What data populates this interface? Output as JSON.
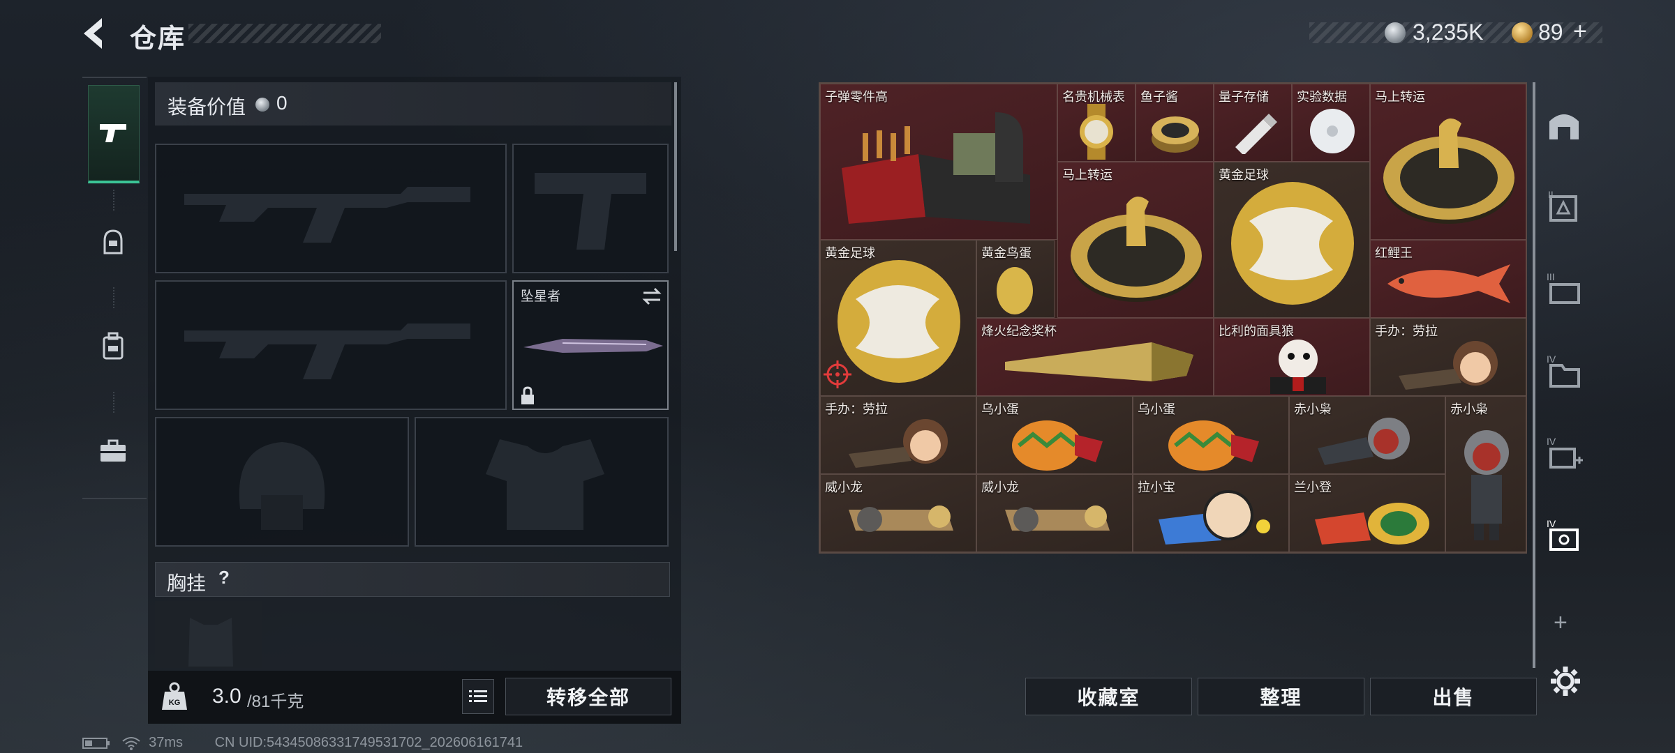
{
  "header": {
    "title": "仓库",
    "currency_silver": "3,235K",
    "currency_gold": "89",
    "gold_plus": "+"
  },
  "left_nav": {
    "items": [
      {
        "name": "weapon",
        "icon": "pistol-icon"
      },
      {
        "name": "helmet",
        "icon": "helmet-icon"
      },
      {
        "name": "backpack",
        "icon": "backpack-icon"
      },
      {
        "name": "case",
        "icon": "briefcase-icon"
      }
    ]
  },
  "loadout": {
    "equipment_value_label": "装备价值",
    "equipment_value": "0",
    "melee_label": "坠星者",
    "chest_label": "胸挂",
    "chest_help": "?",
    "weight_current": "3.0",
    "weight_max": "/81千克",
    "kg_badge": "KG",
    "transfer_all": "转移全部"
  },
  "stash": {
    "items": [
      {
        "id": "bullet-parts",
        "label": "子弹零件高",
        "bg": "#4a2225"
      },
      {
        "id": "luxury-watch",
        "label": "名贵机械表",
        "bg": "#4a2225"
      },
      {
        "id": "caviar",
        "label": "鱼子酱",
        "bg": "#4a2225"
      },
      {
        "id": "quantum-storage",
        "label": "量子存储",
        "bg": "#4a2225"
      },
      {
        "id": "experiment-data",
        "label": "实验数据",
        "bg": "#4a2225"
      },
      {
        "id": "horse-fortune-1",
        "label": "马上转运",
        "bg": "#4a2225"
      },
      {
        "id": "horse-fortune-2",
        "label": "马上转运",
        "bg": "#4a2225"
      },
      {
        "id": "golden-ball-1",
        "label": "黄金足球",
        "bg": "#3b2e28"
      },
      {
        "id": "golden-ball-2",
        "label": "黄金足球",
        "bg": "#3b2e28"
      },
      {
        "id": "golden-egg",
        "label": "黄金鸟蛋",
        "bg": "#3b2e28"
      },
      {
        "id": "red-carp",
        "label": "红鲤王",
        "bg": "#4a2225"
      },
      {
        "id": "beacon-cup",
        "label": "烽火纪念奖杯",
        "bg": "#4a2225"
      },
      {
        "id": "billy-mask",
        "label": "比利的面具狼",
        "bg": "#4a2225"
      },
      {
        "id": "figure-laura-1",
        "label": "手办：劳拉",
        "bg": "#3b2e28"
      },
      {
        "id": "figure-laura-2",
        "label": "手办：劳拉",
        "bg": "#3b2e28"
      },
      {
        "id": "wu-egg-1",
        "label": "乌小蛋",
        "bg": "#3b2e28"
      },
      {
        "id": "wu-egg-2",
        "label": "乌小蛋",
        "bg": "#3b2e28"
      },
      {
        "id": "chi-xiao-xiao-1",
        "label": "赤小枭",
        "bg": "#3b2e28"
      },
      {
        "id": "chi-xiao-xiao-2",
        "label": "赤小枭",
        "bg": "#3b2e28"
      },
      {
        "id": "wei-dragon-1",
        "label": "威小龙",
        "bg": "#3b2e28"
      },
      {
        "id": "wei-dragon-2",
        "label": "威小龙",
        "bg": "#3b2e28"
      },
      {
        "id": "la-xiao",
        "label": "拉小宝",
        "bg": "#3b2e28"
      },
      {
        "id": "lan-xiao-deng",
        "label": "兰小登",
        "bg": "#3b2e28"
      }
    ],
    "buttons": {
      "collection": "收藏室",
      "organize": "整理",
      "sell": "出售"
    }
  },
  "right_nav": {
    "icons": [
      "safehouse-icon",
      "tier-2-bag-icon",
      "tier-3-bag-icon",
      "tier-4-folder-icon",
      "tier-4-medkit-icon",
      "tier-4-case-icon"
    ],
    "add": "+"
  },
  "status": {
    "ping": "37ms",
    "uid": "CN UID:5434508633174953170​2_202606161741"
  },
  "colors": {
    "accent": "#3bc496",
    "stash_bg_red": "#4a2225",
    "stash_bg_brown": "#3b2e28"
  }
}
